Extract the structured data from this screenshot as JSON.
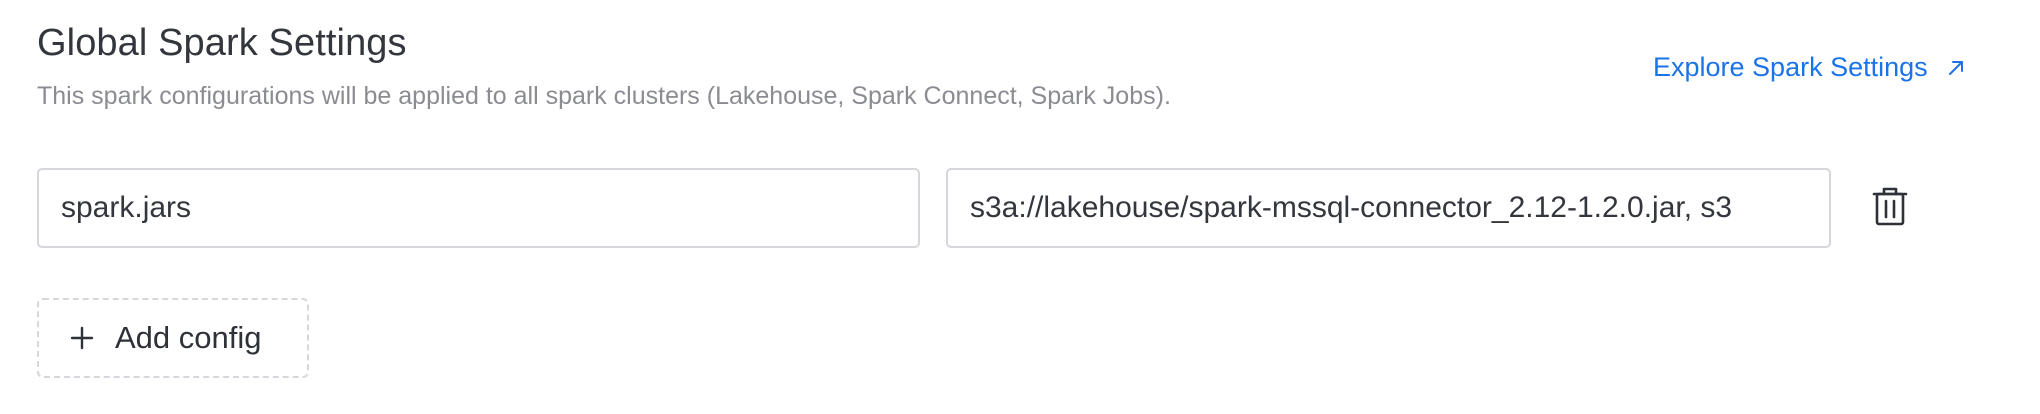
{
  "header": {
    "title": "Global Spark Settings",
    "subtitle": "This spark configurations will be applied to all spark clusters (Lakehouse, Spark Connect, Spark Jobs).",
    "explore_link_label": "Explore Spark Settings",
    "explore_link_icon": "arrow-up-right-icon"
  },
  "configs": [
    {
      "key": "spark.jars",
      "value": "s3a://lakehouse/spark-mssql-connector_2.12-1.2.0.jar, s3",
      "delete_icon": "trash-icon"
    }
  ],
  "add_config": {
    "label": "Add config",
    "icon": "plus-icon"
  },
  "colors": {
    "link": "#1a73e8",
    "title": "#34363d",
    "subtitle": "#8a8c92",
    "border": "#d5d7dc"
  }
}
